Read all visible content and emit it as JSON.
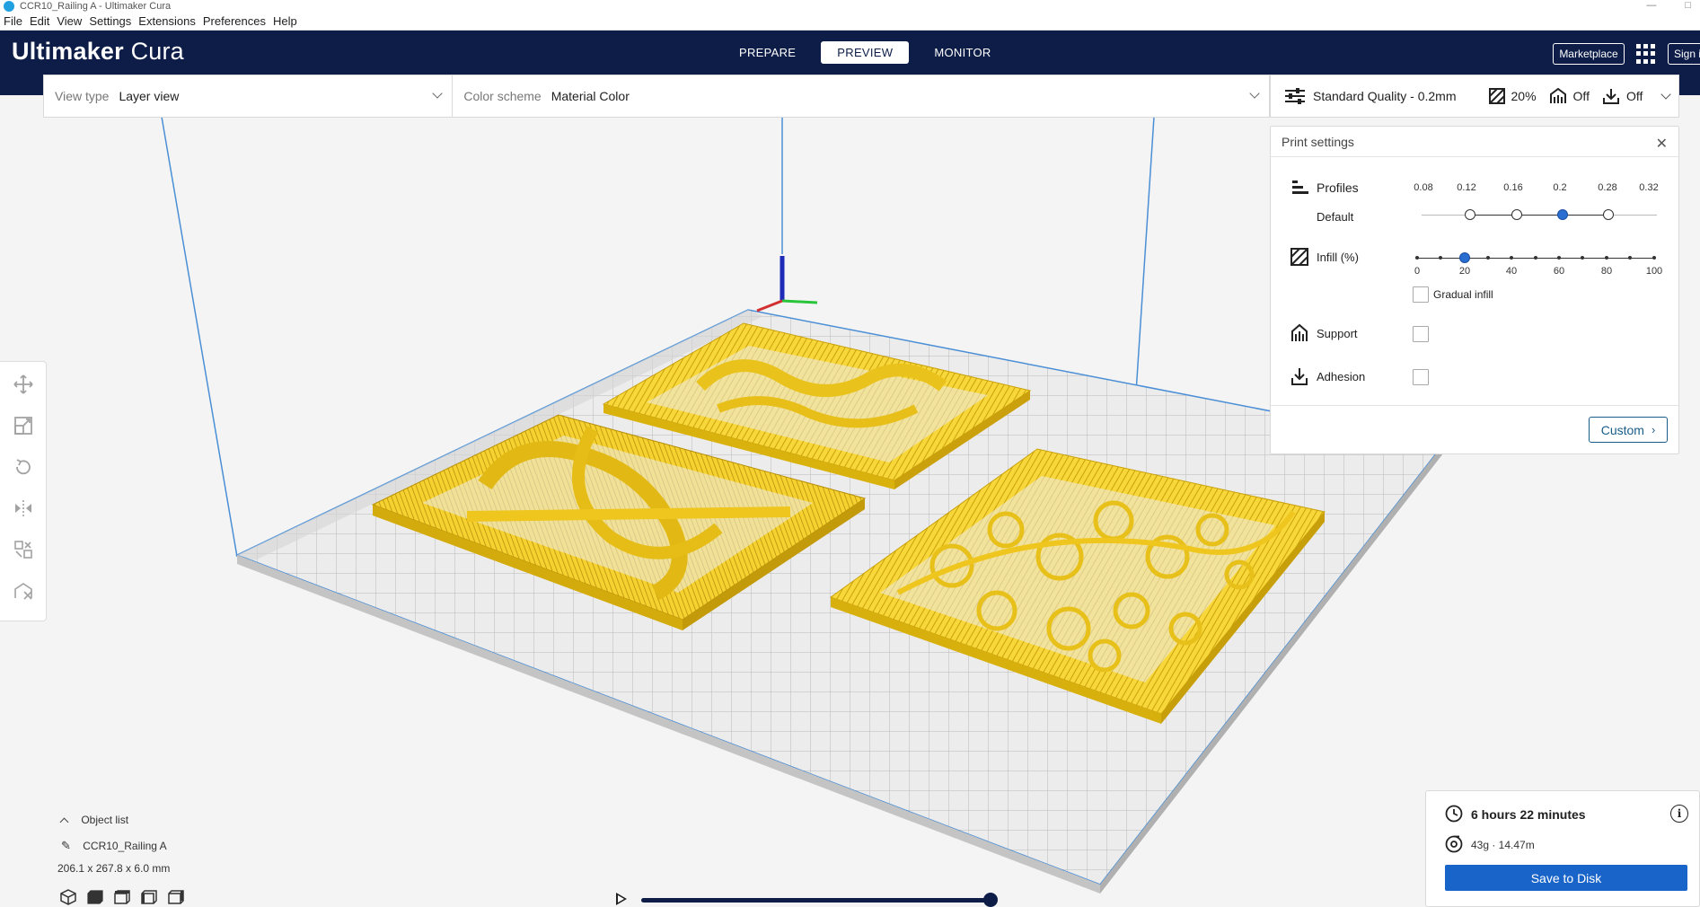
{
  "window": {
    "title": "CCR10_Railing A - Ultimaker Cura"
  },
  "menu": [
    "File",
    "Edit",
    "View",
    "Settings",
    "Extensions",
    "Preferences",
    "Help"
  ],
  "header": {
    "logo_main": "Ultimaker",
    "logo_sub": "Cura",
    "tabs": [
      {
        "label": "PREPARE",
        "active": false
      },
      {
        "label": "PREVIEW",
        "active": true
      },
      {
        "label": "MONITOR",
        "active": false
      }
    ],
    "marketplace": "Marketplace",
    "signin": "Sign in"
  },
  "viewbar": {
    "view_type_label": "View type",
    "view_type_value": "Layer view",
    "color_scheme_label": "Color scheme",
    "color_scheme_value": "Material Color"
  },
  "settingsbar": {
    "quality": "Standard Quality - 0.2mm",
    "infill": "20%",
    "support": "Off",
    "adhesion": "Off"
  },
  "print_settings": {
    "title": "Print settings",
    "profiles_label": "Profiles",
    "default_label": "Default",
    "profile_values": [
      "0.08",
      "0.12",
      "0.16",
      "0.2",
      "0.28",
      "0.32"
    ],
    "profile_selected": "0.2",
    "infill_label": "Infill (%)",
    "infill_ticks": [
      "0",
      "20",
      "40",
      "60",
      "80",
      "100"
    ],
    "infill_value": 20,
    "gradual_infill": "Gradual infill",
    "support_label": "Support",
    "adhesion_label": "Adhesion",
    "custom_button": "Custom"
  },
  "object_list": {
    "toggle_label": "Object list",
    "object_name": "CCR10_Railing A",
    "dimensions": "206.1 x 267.8 x 6.0 mm"
  },
  "job": {
    "time": "6 hours 22 minutes",
    "material": "43g · 14.47m",
    "save_button": "Save to Disk"
  },
  "colors": {
    "header_bg": "#0d1d48",
    "model_yellow": "#f5cf2a",
    "accent_blue": "#1964c8"
  }
}
